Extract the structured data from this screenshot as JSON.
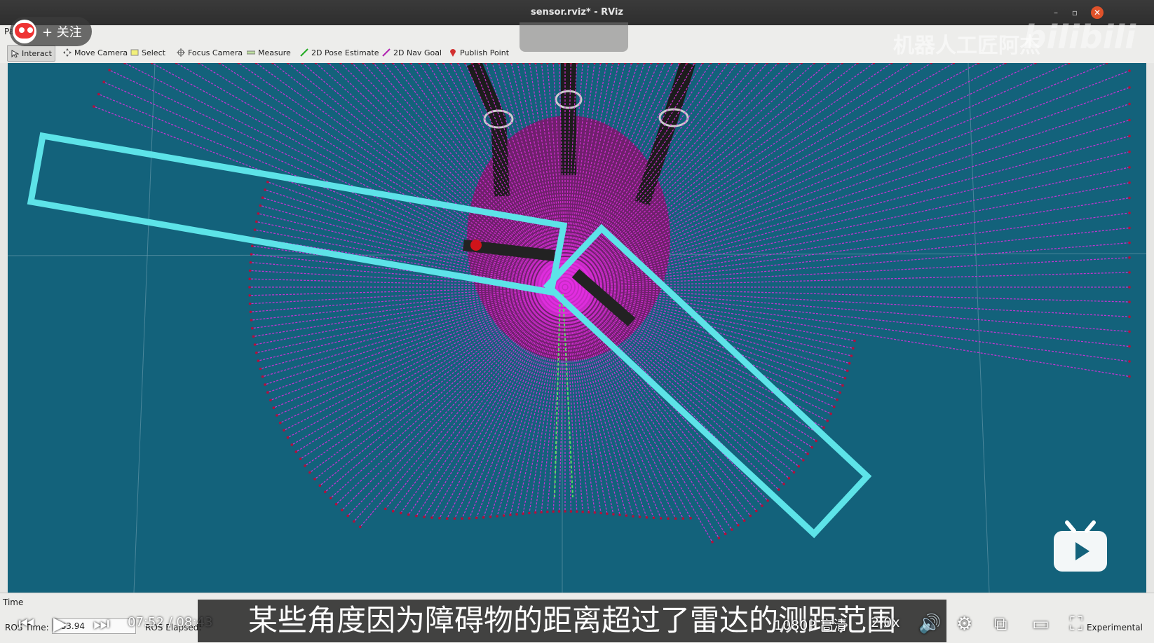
{
  "window": {
    "title": "sensor.rviz* - RViz",
    "minimize": "–",
    "restore": "▫",
    "close": "✕"
  },
  "menu": {
    "panels": "Panels"
  },
  "toolbar": {
    "tools": [
      {
        "label": "Interact",
        "icon": "interact-icon"
      },
      {
        "label": "Move Camera",
        "icon": "move-camera-icon"
      },
      {
        "label": "Select",
        "icon": "select-icon"
      },
      {
        "label": "Focus Camera",
        "icon": "focus-camera-icon"
      },
      {
        "label": "Measure",
        "icon": "measure-icon"
      },
      {
        "label": "2D Pose Estimate",
        "icon": "pose-estimate-icon"
      },
      {
        "label": "2D Nav Goal",
        "icon": "nav-goal-icon"
      },
      {
        "label": "Publish Point",
        "icon": "publish-point-icon"
      }
    ]
  },
  "overlay": {
    "follow_label": "+ 关注",
    "watermark": "机器人工匠阿杰",
    "bili_logo": "bilibili"
  },
  "time_panel": {
    "title": "Time",
    "ros_time_label": "ROS Time:",
    "ros_time_value": "383.94",
    "ros_elapsed_label": "ROS Elapsed:",
    "experimental": "Experimental"
  },
  "player": {
    "current_time": "07:52",
    "separator": "/",
    "total_time": "08:43",
    "quality": "1080P 高清",
    "speed": "2.0x",
    "subtitle": "某些角度因为障碍物的距离超过了雷达的测距范围"
  },
  "colors": {
    "viewport_bg": "#13627b",
    "laser": "#e22ee0",
    "highlight": "#5de3e8"
  }
}
